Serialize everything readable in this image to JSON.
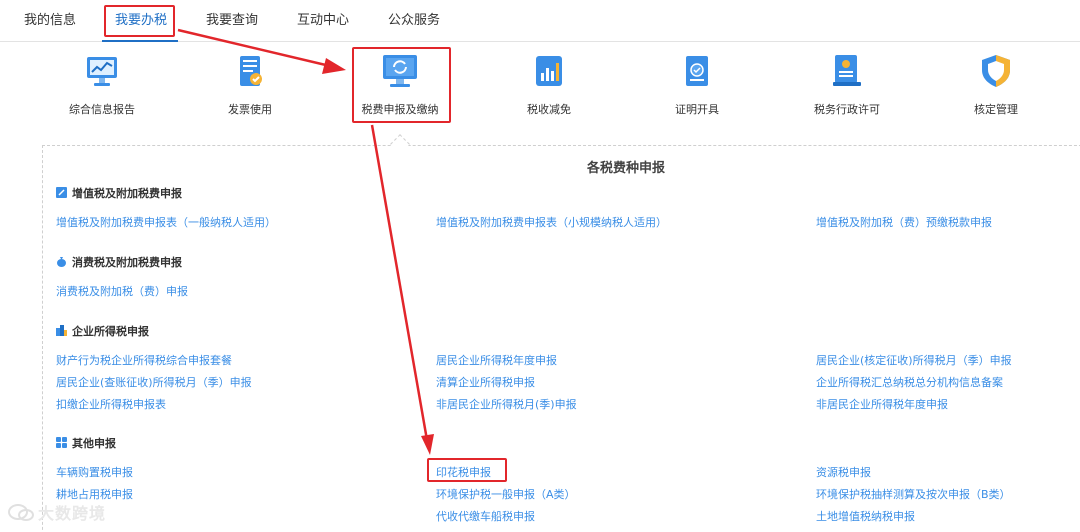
{
  "nav": {
    "tabs": [
      {
        "label": "我的信息"
      },
      {
        "label": "我要办税"
      },
      {
        "label": "我要查询"
      },
      {
        "label": "互动中心"
      },
      {
        "label": "公众服务"
      }
    ],
    "active_tab": "我要办税"
  },
  "categories": [
    {
      "label": "综合信息报告",
      "icon": "monitor-chart-icon"
    },
    {
      "label": "发票使用",
      "icon": "invoice-icon"
    },
    {
      "label": "税费申报及缴纳",
      "icon": "monitor-refresh-icon"
    },
    {
      "label": "税收减免",
      "icon": "bar-chart-icon"
    },
    {
      "label": "证明开具",
      "icon": "certificate-icon"
    },
    {
      "label": "税务行政许可",
      "icon": "license-icon"
    },
    {
      "label": "核定管理",
      "icon": "shield-icon"
    }
  ],
  "panel": {
    "title": "各税费种申报",
    "sections": [
      {
        "heading": "增值税及附加税费申报",
        "icon": "edit-icon",
        "links": [
          "增值税及附加税费申报表（一般纳税人适用）",
          "增值税及附加税费申报表（小规模纳税人适用）",
          "增值税及附加税（费）预缴税款申报"
        ]
      },
      {
        "heading": "消费税及附加税费申报",
        "icon": "money-bag-icon",
        "links": [
          "消费税及附加税（费）申报"
        ]
      },
      {
        "heading": "企业所得税申报",
        "icon": "building-icon",
        "links": [
          "财产行为税企业所得税综合申报套餐",
          "居民企业所得税年度申报",
          "居民企业(核定征收)所得税月（季）申报",
          "居民企业(查账征收)所得税月（季）申报",
          "清算企业所得税申报",
          "企业所得税汇总纳税总分机构信息备案",
          "扣缴企业所得税申报表",
          "非居民企业所得税月(季)申报",
          "非居民企业所得税年度申报"
        ]
      },
      {
        "heading": "其他申报",
        "icon": "grid-icon",
        "links": [
          "车辆购置税申报",
          "印花税申报",
          "资源税申报",
          "耕地占用税申报",
          "环境保护税一般申报（A类）",
          "环境保护税抽样测算及按次申报（B类）",
          "",
          "代收代缴车船税申报",
          "土地增值税纳税申报"
        ]
      }
    ]
  },
  "watermark": {
    "text": "大数跨境"
  },
  "colors": {
    "accent": "#1f6fc5",
    "link": "#3a8ee6",
    "highlight": "#e2262b"
  }
}
